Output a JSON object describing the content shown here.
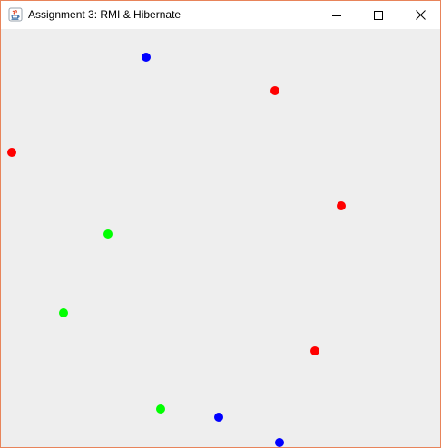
{
  "window": {
    "title": "Assignment 3: RMI & Hibernate",
    "app_icon": "java-icon",
    "controls": [
      "minimize-icon",
      "maximize-icon",
      "close-icon"
    ]
  },
  "canvas": {
    "background": "#eeeeee",
    "balls": [
      {
        "color": "#0000ff"
      },
      {
        "color": "#ff0000"
      },
      {
        "color": "#ff0000"
      },
      {
        "color": "#ff0000"
      },
      {
        "color": "#00ff00"
      },
      {
        "color": "#00ff00"
      },
      {
        "color": "#ff0000"
      },
      {
        "color": "#00ff00"
      },
      {
        "color": "#0000ff"
      },
      {
        "color": "#0000ff"
      }
    ]
  }
}
